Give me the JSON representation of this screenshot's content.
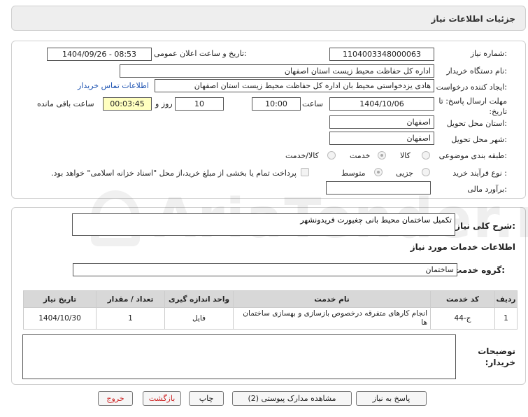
{
  "page_title": "جزئیات اطلاعات نیاز",
  "fields": {
    "need_number_label": "شماره نیاز:",
    "need_number": "1104003348000063",
    "announce_label": "تاریخ و ساعت اعلان عمومی:",
    "announce_value": "1404/09/26 - 08:53",
    "buyer_org_label": "نام دستگاه خریدار:",
    "buyer_org": "اداره کل حفاظت محیط زیست استان اصفهان",
    "creator_label": "ایجاد کننده درخواست:",
    "creator": "هادی یزدخواستی محیط بان اداره کل حفاظت محیط زیست استان اصفهان",
    "contact_link": "اطلاعات تماس خریدار",
    "deadline_label": "مهلت ارسال پاسخ: تا تاریخ:",
    "deadline_date": "1404/10/06",
    "time_label": "ساعت",
    "deadline_time": "10:00",
    "days_value": "10",
    "days_label": "روز و",
    "remaining_time": "00:03:45",
    "remaining_label": "ساعت باقی مانده",
    "province_label": "استان محل تحویل:",
    "province": "اصفهان",
    "city_label": "شهر محل تحویل:",
    "city": "اصفهان",
    "category_label": "طبقه بندی موضوعی:",
    "category_options": [
      "کالا",
      "خدمت",
      "کالا/خدمت"
    ],
    "process_label": "نوع فرآیند خرید :",
    "process_options": [
      "جزیی",
      "متوسط"
    ],
    "payment_note": "پرداخت تمام یا بخشی از مبلغ خرید،از محل \"اسناد خزانه اسلامی\" خواهد بود.",
    "budget_label": "برآورد مالی:",
    "budget_value": ""
  },
  "description": {
    "label": "شرح کلی نیاز:",
    "value": "تکمیل ساختمان محیط بانی چغیورت فریدونشهر"
  },
  "services": {
    "section_title": "اطلاعات خدمات مورد نیاز",
    "group_label": "گروه خدمت:",
    "group_value": "ساختمان",
    "columns": [
      "ردیف",
      "کد خدمت",
      "نام خدمت",
      "واحد اندازه گیری",
      "تعداد / مقدار",
      "تاریخ نیاز"
    ],
    "rows": [
      [
        "1",
        "ج-44",
        "انجام کارهای متفرقه درخصوص بازسازی و بهسازی ساختمان ها",
        "فایل",
        "1",
        "1404/10/30"
      ]
    ]
  },
  "buyer_notes": {
    "label": "توضیحات خریدار:",
    "value": ""
  },
  "buttons": {
    "reply": "پاسخ به نیاز",
    "attachments": "مشاهده مدارک پیوستی (2)",
    "print": "چاپ",
    "back": "بازگشت",
    "exit": "خروج"
  },
  "watermark": "AriaTender.neT",
  "colors": {
    "link": "#1a50b0",
    "remaining_bg": "#ffffc0",
    "exit_text": "#cc2222"
  }
}
